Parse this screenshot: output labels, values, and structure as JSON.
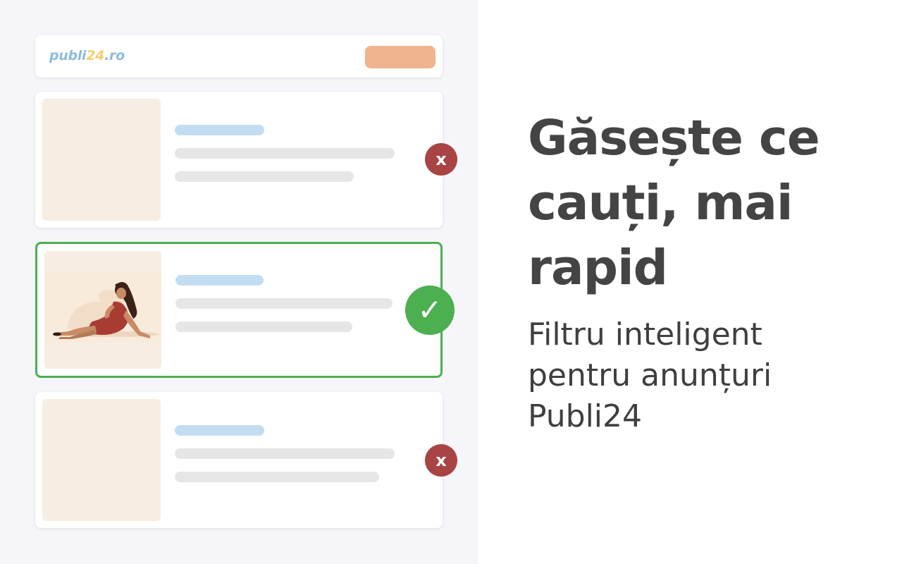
{
  "header": {
    "logo_main": "publi",
    "logo_accent": "24",
    "logo_suffix": ".ro"
  },
  "cards": [
    {
      "status": "rejected",
      "mark_symbol": "x"
    },
    {
      "status": "selected",
      "mark_symbol": "✓"
    },
    {
      "status": "rejected",
      "mark_symbol": "x"
    }
  ],
  "hero": {
    "headline_line1": "Găsește ce",
    "headline_line2": "cauți, mai",
    "headline_line3": "rapid",
    "subline_line1": "Filtru inteligent",
    "subline_line2": "pentru anunțuri",
    "subline_line3": "Publi24"
  },
  "colors": {
    "accept": "#4caf50",
    "reject": "#a94444",
    "header_button": "#f0b48f",
    "title_bar": "#c2ddf1",
    "text_bar": "#e6e6e6",
    "thumbnail": "#f6ede3"
  },
  "icons": {
    "reject": "x-mark-icon",
    "accept": "check-mark-icon",
    "listing_image": "reclining-woman-illustration"
  }
}
